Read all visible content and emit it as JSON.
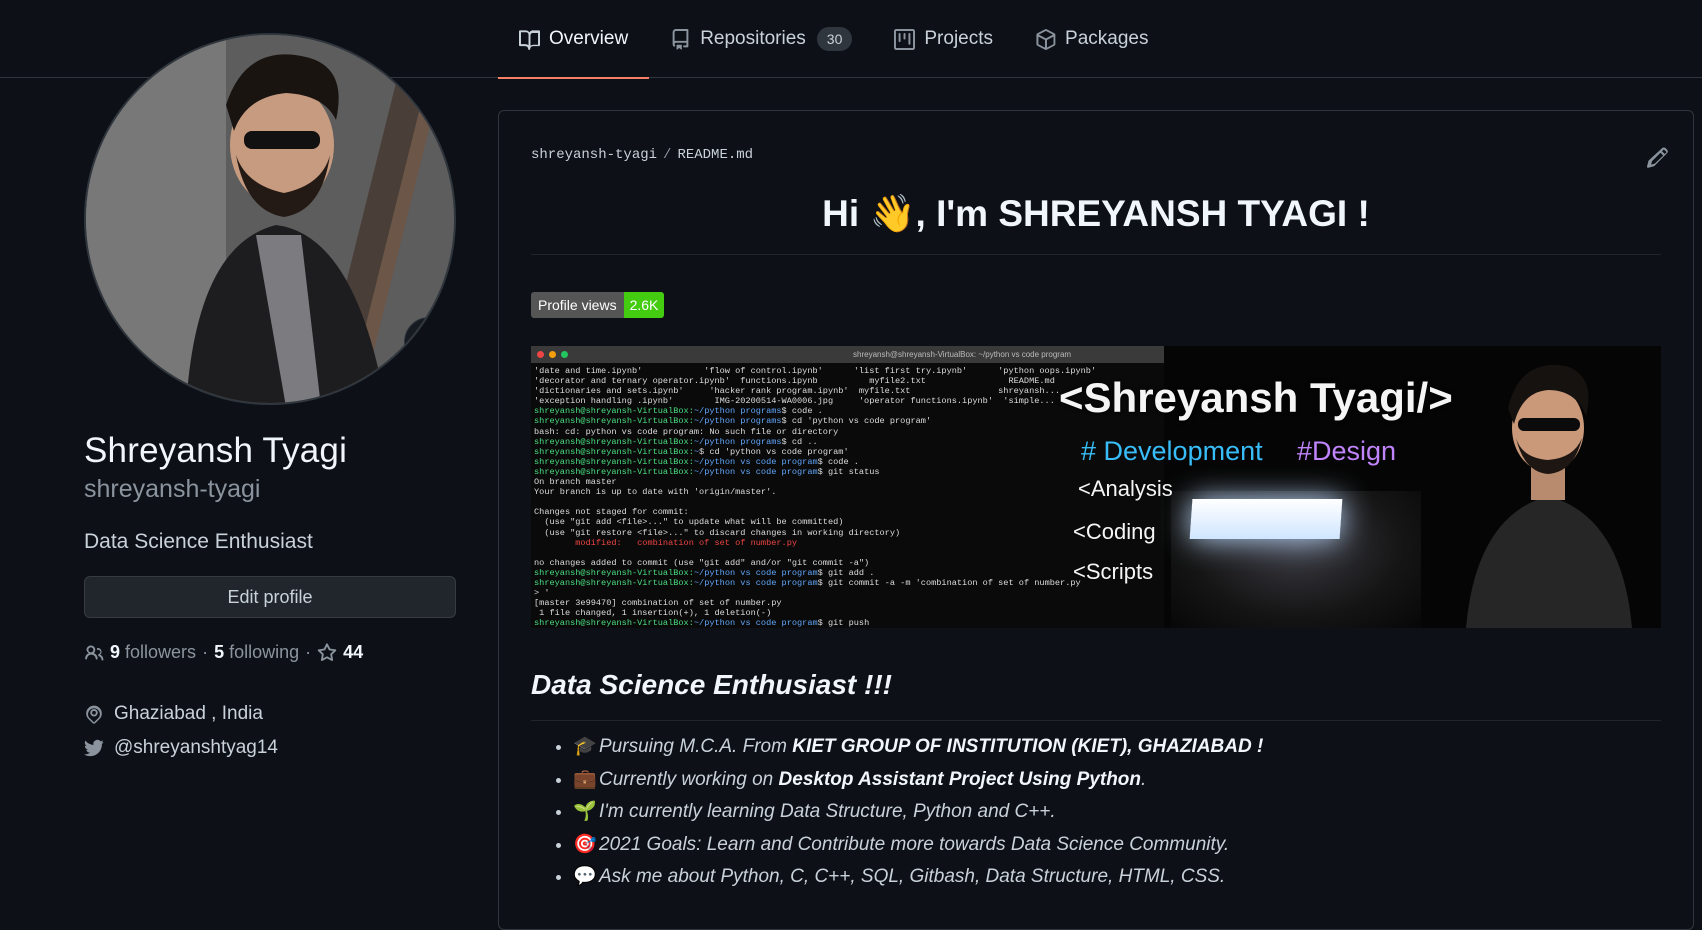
{
  "nav": {
    "tabs": [
      {
        "label": "Overview",
        "icon": "book-icon",
        "active": true
      },
      {
        "label": "Repositories",
        "icon": "repo-icon",
        "count": "30"
      },
      {
        "label": "Projects",
        "icon": "project-icon"
      },
      {
        "label": "Packages",
        "icon": "package-icon"
      }
    ]
  },
  "profile": {
    "fullname": "Shreyansh Tyagi",
    "username": "shreyansh-tyagi",
    "bio": "Data Science Enthusiast",
    "edit_label": "Edit profile",
    "status_emoji": "🐍",
    "followers_count": "9",
    "followers_label": "followers",
    "following_count": "5",
    "following_label": "following",
    "stars_count": "44",
    "separator": "·",
    "location": "Ghaziabad , India",
    "twitter": "@shreyanshtyag14"
  },
  "readme": {
    "owner": "shreyansh-tyagi",
    "separator": "/",
    "file": "README.md",
    "greeting": "Hi 👋, I'm SHREYANSH TYAGI !",
    "views_label": "Profile views",
    "views_value": "2.6K",
    "banner": {
      "title": "<Shreyansh Tyagi/>",
      "tag_dev": "# Development",
      "tag_design": "#Design",
      "line1": "<Analysis",
      "line2": "<Coding",
      "line3": "<Scripts",
      "window_title": "shreyansh@shreyansh-VirtualBox: ~/python vs code program",
      "terminal": [
        "'date and time.ipynb'            'flow of control.ipynb'      'list first try.ipynb'      'python oops.ipynb'",
        "'decorator and ternary operator.ipynb'  functions.ipynb          myfile2.txt                README.md",
        "'dictionaries and sets.ipynb'     'hacker rank program.ipynb'  myfile.txt                 shreyansh...",
        "'exception handling .ipynb'        IMG-20200514-WA0006.jpg     'operator functions.ipynb'  'simple...",
        "shreyansh@shreyansh-VirtualBox:~/python programs$ code .",
        "shreyansh@shreyansh-VirtualBox:~/python programs$ cd 'python vs code program'",
        "bash: cd: python vs code program: No such file or directory",
        "shreyansh@shreyansh-VirtualBox:~/python programs$ cd ..",
        "shreyansh@shreyansh-VirtualBox:~$ cd 'python vs code program'",
        "shreyansh@shreyansh-VirtualBox:~/python vs code program$ code .",
        "shreyansh@shreyansh-VirtualBox:~/python vs code program$ git status",
        "On branch master",
        "Your branch is up to date with 'origin/master'.",
        "",
        "Changes not staged for commit:",
        "  (use \"git add <file>...\" to update what will be committed)",
        "  (use \"git restore <file>...\" to discard changes in working directory)",
        "        modified:   combination of set of number.py",
        "",
        "no changes added to commit (use \"git add\" and/or \"git commit -a\")",
        "shreyansh@shreyansh-VirtualBox:~/python vs code program$ git add .",
        "shreyansh@shreyansh-VirtualBox:~/python vs code program$ git commit -a -m 'combination of set of number.py",
        "> '",
        "[master 3e99470] combination of set of number.py",
        " 1 file changed, 1 insertion(+), 1 deletion(-)",
        "shreyansh@shreyansh-VirtualBox:~/python vs code program$ git push"
      ]
    },
    "heading": "Data Science Enthusiast !!!",
    "bullets": [
      {
        "emoji": "🎓",
        "text": "Pursuing M.C.A. From ",
        "strong": "KIET GROUP OF INSTITUTION (KIET), GHAZIABAD !",
        "tail": ""
      },
      {
        "emoji": "💼",
        "text": "Currently working on ",
        "strong": "Desktop Assistant Project Using Python",
        "tail": "."
      },
      {
        "emoji": "🌱",
        "text": "I'm currently learning Data Structure, Python and C++.",
        "strong": "",
        "tail": ""
      },
      {
        "emoji": "🎯",
        "text": "2021 Goals: Learn and Contribute more towards Data Science Community.",
        "strong": "",
        "tail": ""
      },
      {
        "emoji": "💬",
        "text": "Ask me about Python, C, C++, SQL, Gitbash, Data Structure, HTML, CSS.",
        "strong": "",
        "tail": ""
      }
    ]
  }
}
